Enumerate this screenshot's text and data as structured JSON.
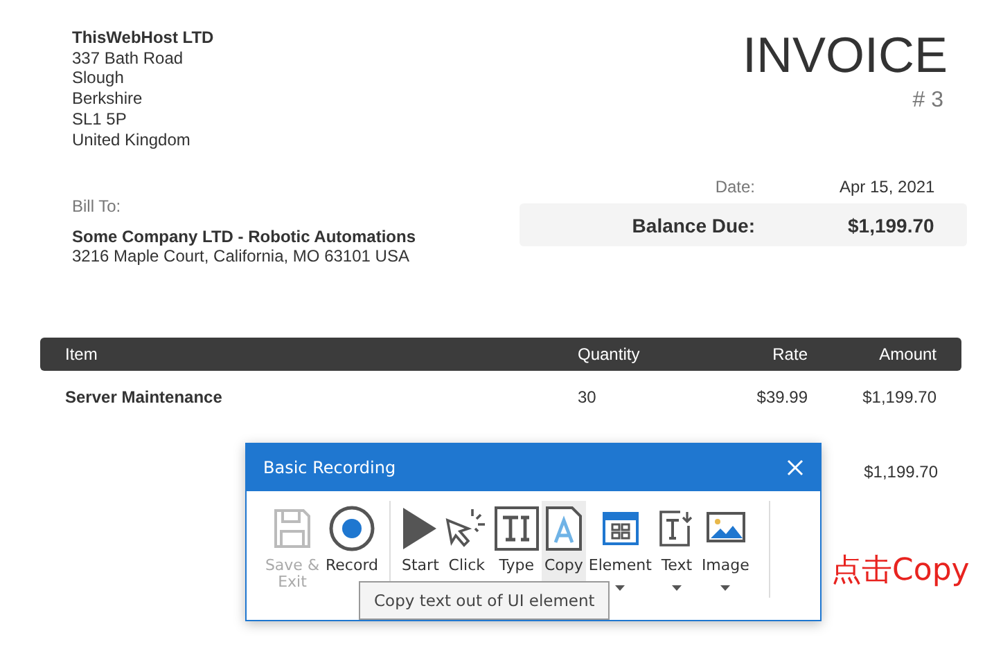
{
  "invoice": {
    "from": [
      "ThisWebHost LTD",
      "337 Bath Road",
      "Slough",
      "Berkshire",
      "SL1 5P",
      "United Kingdom"
    ],
    "title": "INVOICE",
    "number": "# 3",
    "bill_to_label": "Bill To:",
    "bill_to_name": "Some Company LTD - Robotic Automations",
    "bill_to_address": "3216 Maple Court, California, MO 63101 USA",
    "date_label": "Date:",
    "date": "Apr 15, 2021",
    "balance_label": "Balance Due:",
    "balance": "$1,199.70"
  },
  "table": {
    "columns": [
      "Item",
      "Quantity",
      "Rate",
      "Amount"
    ],
    "rows": [
      [
        "Server Maintenance",
        "30",
        "$39.99",
        "$1,199.70"
      ]
    ]
  },
  "subtotal": "$1,199.70",
  "dialog": {
    "title": "Basic Recording",
    "tools": [
      {
        "kind": "save",
        "label": "Save & Exit",
        "disabled": true,
        "selected": false,
        "dropdown": false
      },
      {
        "kind": "record",
        "label": "Record",
        "disabled": false,
        "selected": false,
        "dropdown": false
      },
      {
        "kind": "start",
        "label": "Start",
        "disabled": false,
        "selected": false,
        "dropdown": false
      },
      {
        "kind": "click",
        "label": "Click",
        "disabled": false,
        "selected": false,
        "dropdown": false
      },
      {
        "kind": "type",
        "label": "Type",
        "disabled": false,
        "selected": false,
        "dropdown": false
      },
      {
        "kind": "copy",
        "label": "Copy",
        "disabled": false,
        "selected": true,
        "dropdown": false
      },
      {
        "kind": "element",
        "label": "Element",
        "disabled": false,
        "selected": false,
        "dropdown": true
      },
      {
        "kind": "text",
        "label": "Text",
        "disabled": false,
        "selected": false,
        "dropdown": true
      },
      {
        "kind": "image",
        "label": "Image",
        "disabled": false,
        "selected": false,
        "dropdown": true
      }
    ],
    "tooltip": "Copy text out of UI element"
  },
  "annotation": "点击Copy"
}
